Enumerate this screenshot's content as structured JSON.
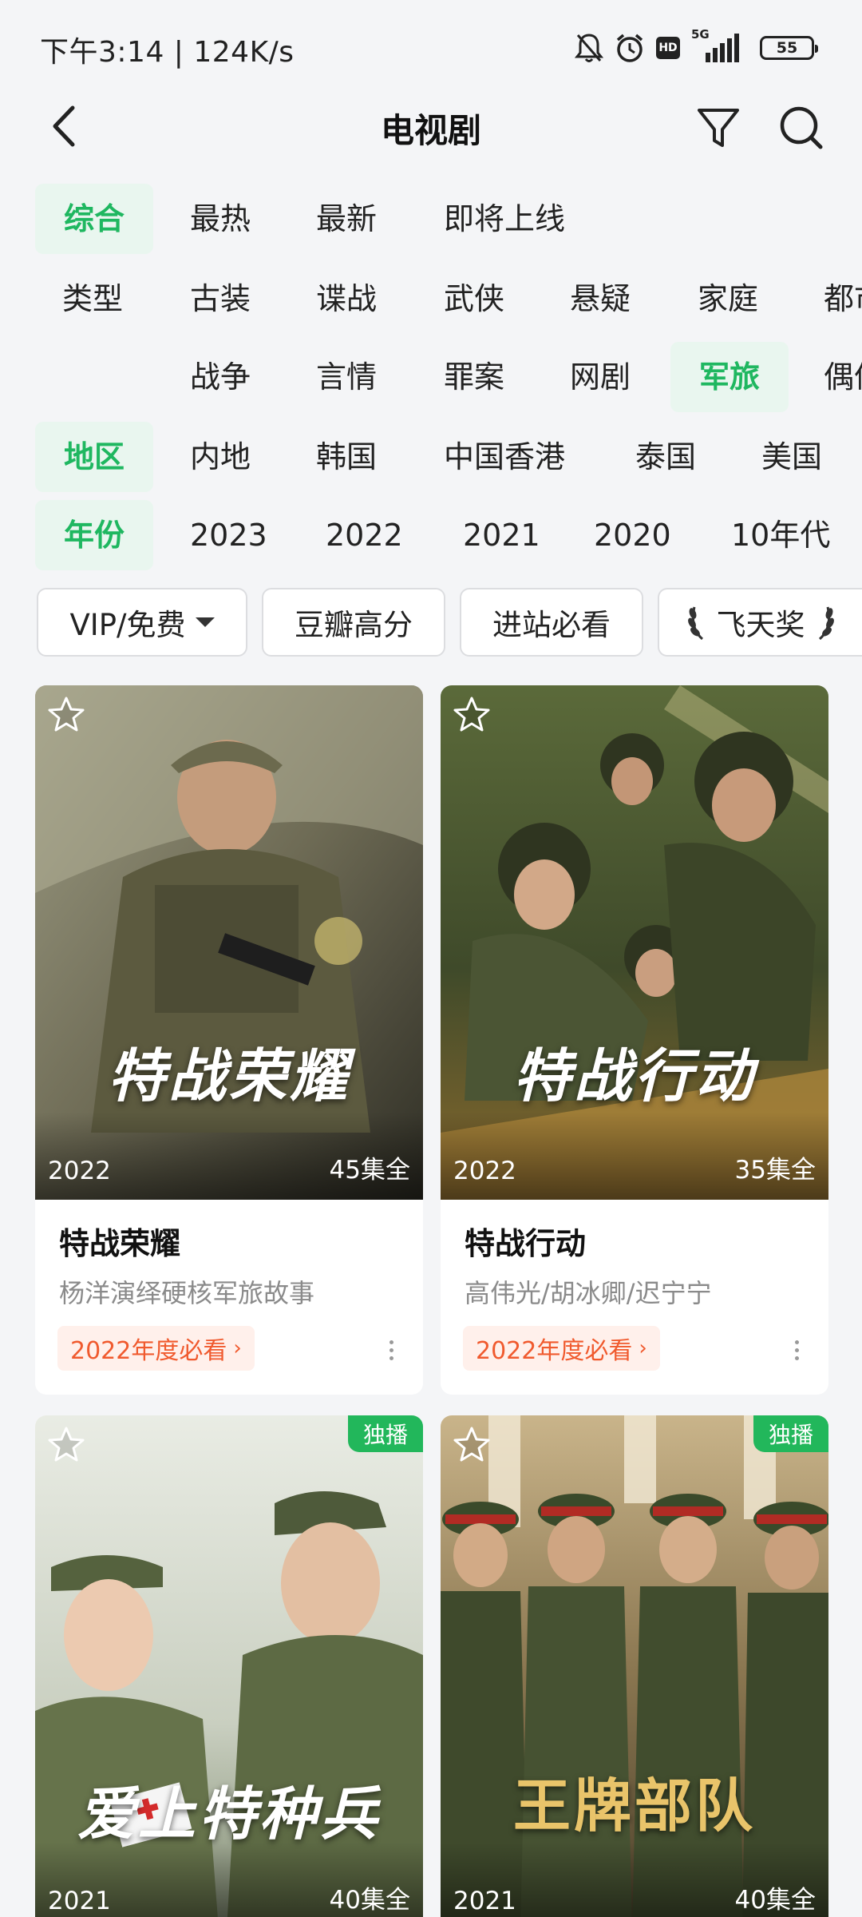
{
  "status_bar": {
    "left_text": "下午3:14 | 124K/s",
    "network_label": "5G",
    "hd_label": "HD",
    "battery_level": "55"
  },
  "header": {
    "title": "电视剧"
  },
  "filters": {
    "sort": {
      "options": [
        "综合",
        "最热",
        "最新",
        "即将上线"
      ],
      "selected": "综合"
    },
    "genre_row1": {
      "label": "类型",
      "options": [
        "古装",
        "谍战",
        "武侠",
        "悬疑",
        "家庭",
        "都市"
      ]
    },
    "genre_row2": {
      "options": [
        "战争",
        "言情",
        "罪案",
        "网剧",
        "军旅",
        "偶像"
      ],
      "selected": "军旅"
    },
    "region": {
      "label": "地区",
      "options": [
        "内地",
        "韩国",
        "中国香港",
        "泰国",
        "美国"
      ]
    },
    "year": {
      "label": "年份",
      "options": [
        "2023",
        "2022",
        "2021",
        "2020",
        "10年代"
      ]
    }
  },
  "tag_buttons": {
    "vip": "VIP/免费",
    "douban": "豆瓣高分",
    "theater": "进站必看",
    "award": "飞天奖"
  },
  "cards": [
    {
      "poster_title": "特战荣耀",
      "year": "2022",
      "episodes": "45集全",
      "title": "特战荣耀",
      "subtitle": "杨洋演绎硬核军旅故事",
      "rank": "2022年度必看",
      "exclusive": ""
    },
    {
      "poster_title": "特战行动",
      "year": "2022",
      "episodes": "35集全",
      "title": "特战行动",
      "subtitle": "高伟光/胡冰卿/迟宁宁",
      "rank": "2022年度必看",
      "exclusive": ""
    },
    {
      "poster_title": "爱上特种兵",
      "year": "2021",
      "episodes": "40集全",
      "title": "",
      "subtitle": "",
      "rank": "",
      "exclusive": "独播"
    },
    {
      "poster_title": "王牌部队",
      "year": "2021",
      "episodes": "40集全",
      "title": "",
      "subtitle": "",
      "rank": "",
      "exclusive": "独播"
    }
  ],
  "colors": {
    "accent": "#1fb760",
    "selected_bg": "#e9f6ef",
    "rank_text": "#f05a2e",
    "rank_bg": "#fff0eb",
    "badge_green": "#22b75b"
  },
  "icons": [
    "back-arrow-icon",
    "filter-funnel-icon",
    "search-icon",
    "star-outline-icon",
    "more-vertical-icon",
    "bell-off-icon",
    "alarm-icon",
    "signal-icon",
    "battery-icon",
    "laurel-icon"
  ]
}
